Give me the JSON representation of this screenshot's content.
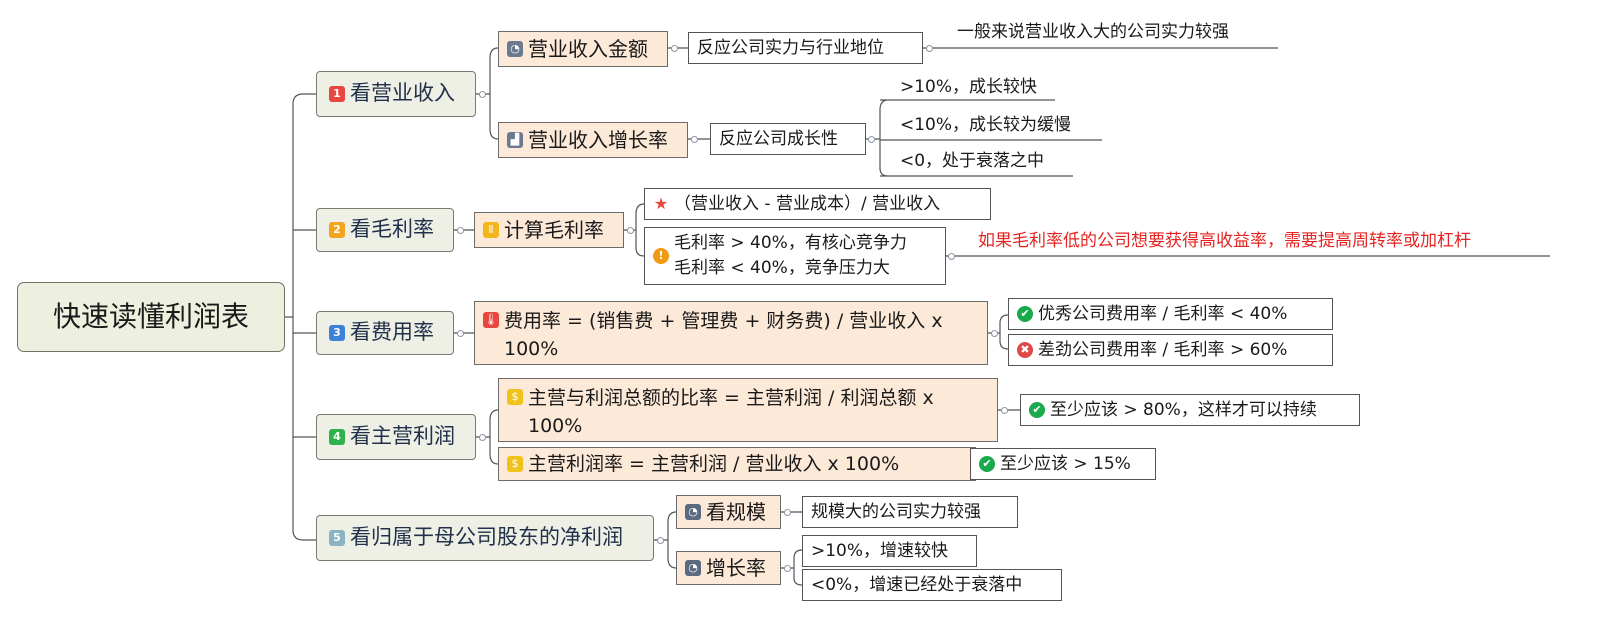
{
  "root": "快速读懂利润表",
  "branches": [
    {
      "num": "1",
      "label": "看营业收入",
      "color": "#e8473f"
    },
    {
      "num": "2",
      "label": "看毛利率",
      "color": "#f2a41c"
    },
    {
      "num": "3",
      "label": "看费用率",
      "color": "#3b82d6"
    },
    {
      "num": "4",
      "label": "看主营利润",
      "color": "#2eb24b"
    },
    {
      "num": "5",
      "label": "看归属于母公司股东的净利润",
      "color": "#8ab4c0"
    }
  ],
  "b1": {
    "amount": "营业收入金额",
    "amount_desc": "反应公司实力与行业地位",
    "amount_note": "一般来说营业收入大的公司实力较强",
    "growth": "营业收入增长率",
    "growth_desc": "反应公司成长性",
    "growth_items": [
      ">10%，成长较快",
      "<10%，成长较为缓慢",
      "<0，处于衰落之中"
    ]
  },
  "b2": {
    "calc": "计算毛利率",
    "formula": "（营业收入 - 营业成本）/ 营业收入",
    "line1": "毛利率 > 40%，有核心竞争力",
    "line2": "毛利率 < 40%，竞争压力大",
    "note": "如果毛利率低的公司想要获得高收益率，需要提高周转率或加杠杆"
  },
  "b3": {
    "formula": "费用率 = (销售费 + 管理费 + 财务费) / 营业收入 x 100%",
    "good": "优秀公司费用率 / 毛利率 < 40%",
    "bad": "差劲公司费用率 / 毛利率 > 60%"
  },
  "b4": {
    "ratio": "主营与利润总额的比率 = 主营利润 / 利润总额 x 100%",
    "ratio_note": "至少应该 > 80%，这样才可以持续",
    "margin": "主营利润率 = 主营利润 / 营业收入 x 100%",
    "margin_note": "至少应该 > 15%"
  },
  "b5": {
    "scale": "看规模",
    "scale_desc": "规模大的公司实力较强",
    "growth": "增长率",
    "growth_items": [
      ">10%，增速较快",
      "<0%，增速已经处于衰落中"
    ]
  },
  "colors": {
    "accent_red": "#e52421",
    "peach": "#fde9d8",
    "root_bg": "#edf0df",
    "branch_bg": "#eef0e6"
  }
}
